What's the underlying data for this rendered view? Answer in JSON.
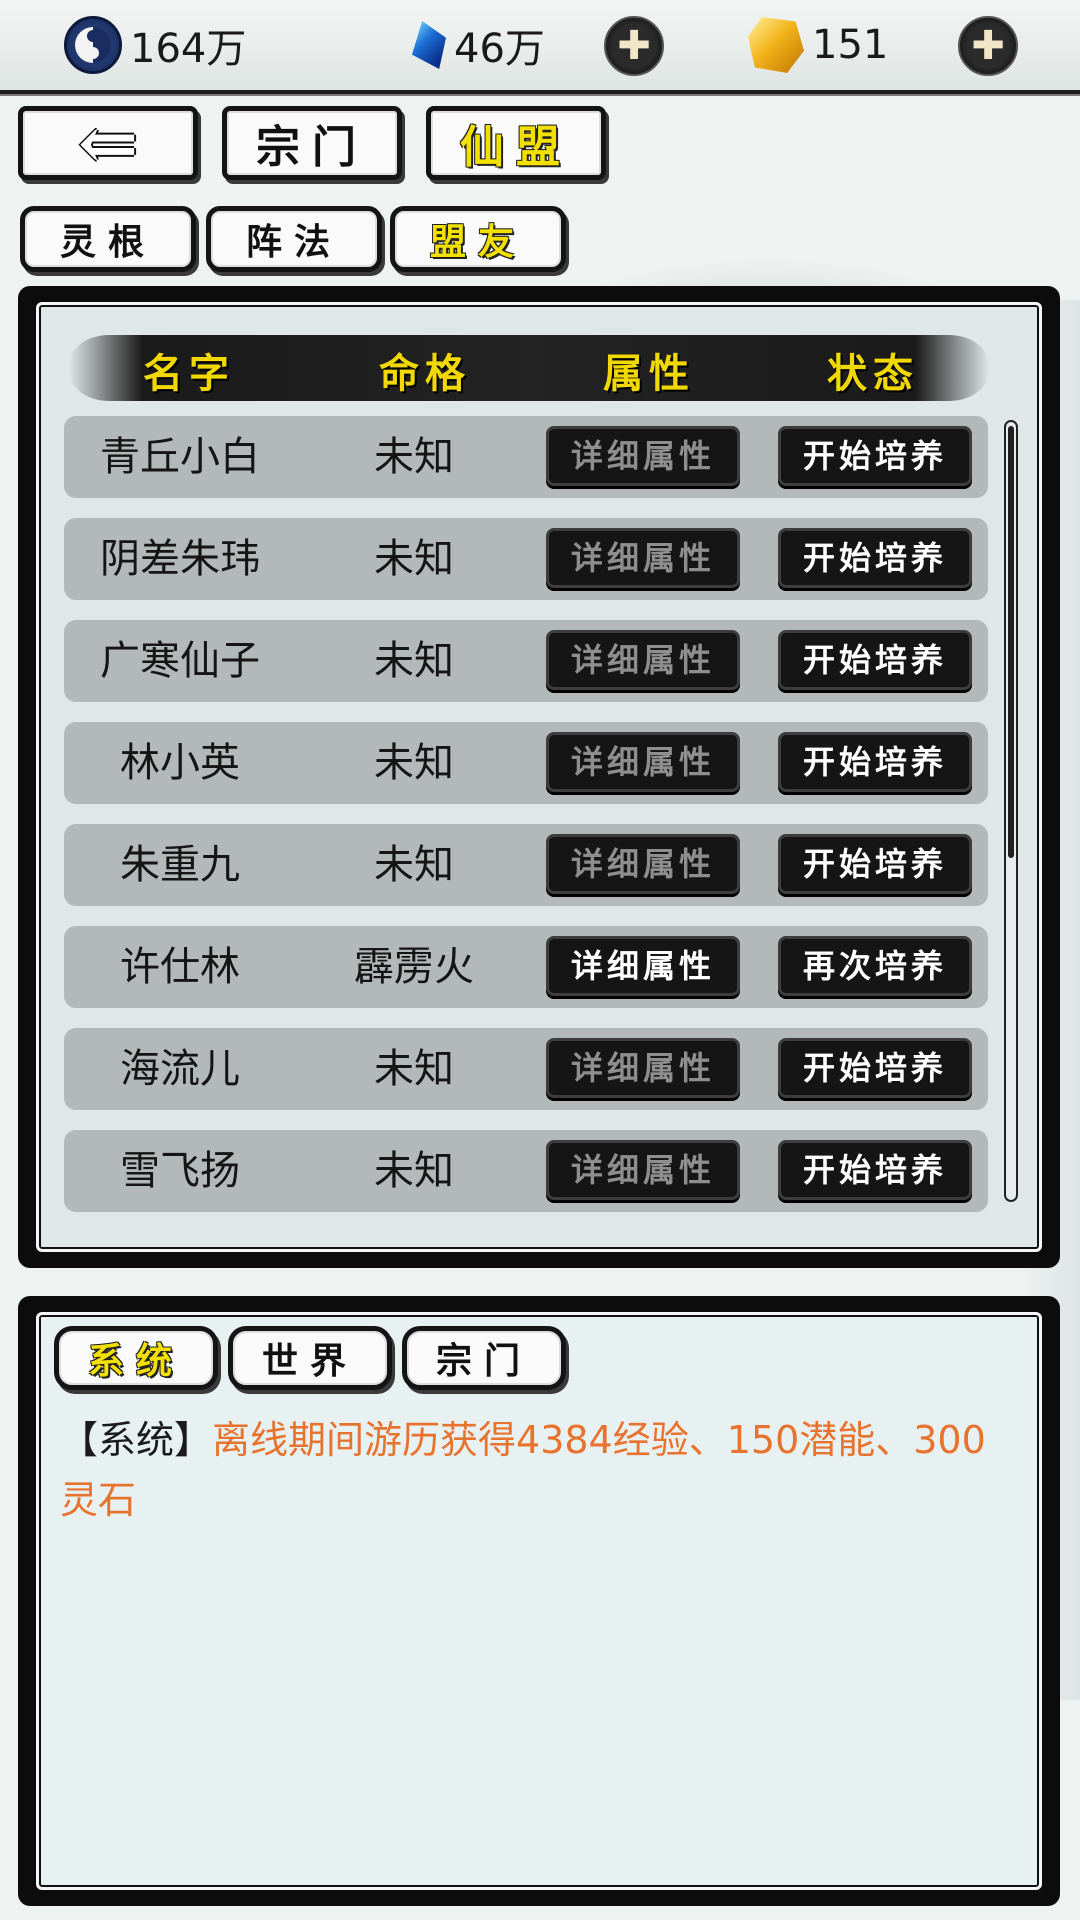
{
  "resources": {
    "yinyang_value": "164万",
    "gem_value": "46万",
    "gold_value": "151",
    "plus_symbol": "✚"
  },
  "nav": {
    "back_symbol": "⇐",
    "tabs": [
      "宗门",
      "仙盟"
    ],
    "active_tab": "仙盟",
    "subtabs": [
      "灵根",
      "阵法",
      "盟友"
    ],
    "active_subtab": "盟友"
  },
  "table": {
    "headers": [
      "名字",
      "命格",
      "属性",
      "状态"
    ],
    "rows": [
      {
        "name": "青丘小白",
        "fate": "未知",
        "detail": "详细属性",
        "action": "开始培养"
      },
      {
        "name": "阴差朱玮",
        "fate": "未知",
        "detail": "详细属性",
        "action": "开始培养"
      },
      {
        "name": "广寒仙子",
        "fate": "未知",
        "detail": "详细属性",
        "action": "开始培养"
      },
      {
        "name": "林小英",
        "fate": "未知",
        "detail": "详细属性",
        "action": "开始培养"
      },
      {
        "name": "朱重九",
        "fate": "未知",
        "detail": "详细属性",
        "action": "开始培养"
      },
      {
        "name": "许仕林",
        "fate": "霹雳火",
        "detail": "详细属性",
        "action": "再次培养"
      },
      {
        "name": "海流儿",
        "fate": "未知",
        "detail": "详细属性",
        "action": "开始培养"
      },
      {
        "name": "雪飞扬",
        "fate": "未知",
        "detail": "详细属性",
        "action": "开始培养"
      }
    ]
  },
  "chat": {
    "tabs": [
      "系统",
      "世界",
      "宗门"
    ],
    "active_tab": "系统",
    "message_prefix": "【系统】",
    "message_text": "离线期间游历获得4384经验、150潜能、300灵石"
  },
  "colors": {
    "active_label": "#f2e000",
    "message_highlight": "#e8732e"
  }
}
